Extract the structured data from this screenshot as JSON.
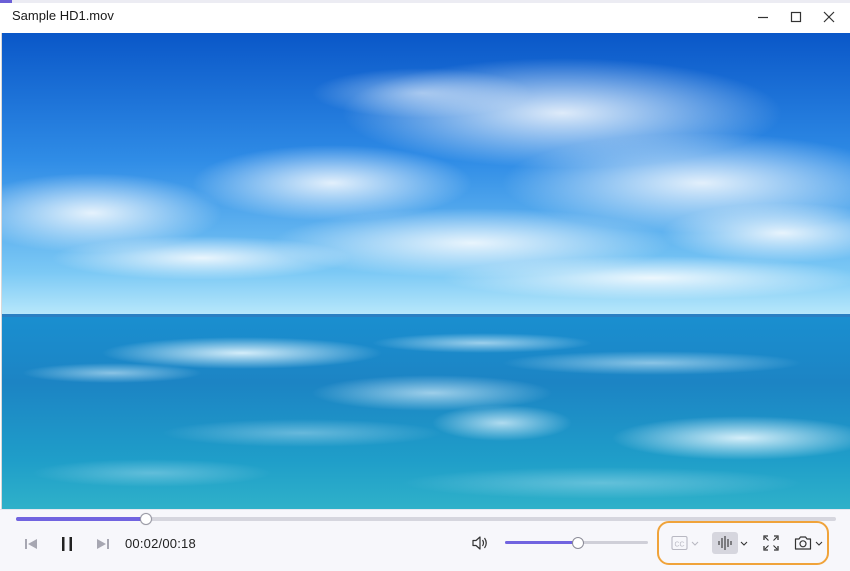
{
  "window": {
    "title": "Sample HD1.mov"
  },
  "player": {
    "time_display": "00:02/00:18",
    "progress_fraction": 0.158,
    "volume_fraction": 0.5,
    "is_playing": true
  },
  "controls": {
    "icons": [
      "previous-icon",
      "pause-icon",
      "next-icon",
      "volume-icon",
      "subtitles-icon",
      "audio-track-icon",
      "fullscreen-icon",
      "screenshot-icon"
    ]
  },
  "colors": {
    "accent": "#7164e0",
    "highlight": "#f0a33a"
  }
}
